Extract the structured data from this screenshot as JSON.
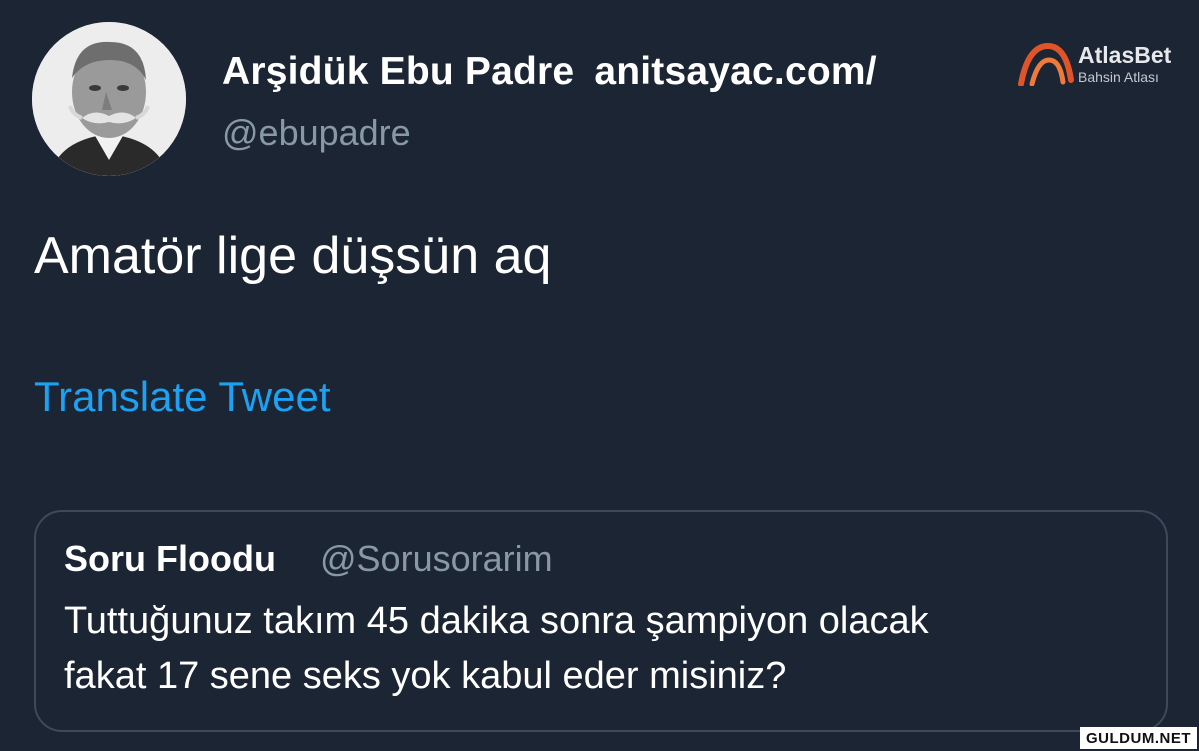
{
  "author": {
    "display_name": "Arşidük Ebu Padre",
    "display_name_suffix": "anitsayac.com/",
    "handle": "@ebupadre",
    "avatar": "profile-photo"
  },
  "brand": {
    "name": "AtlasBet",
    "tagline": "Bahsin Atlası",
    "logo": "atlasbet-arc-logo",
    "accent": "#e0542a"
  },
  "tweet": {
    "text": "Amatör lige düşsün aq",
    "translate_label": "Translate Tweet"
  },
  "quoted_tweet": {
    "name": "Soru Floodu",
    "handle": "@Sorusorarim",
    "line1": "Tuttuğunuz takım 45 dakika sonra şampiyon olacak",
    "line2": "fakat 17 sene seks yok kabul eder misiniz?"
  },
  "watermark": "GULDUM.NET",
  "colors": {
    "background": "#1c2533",
    "link": "#1da1f2",
    "secondary_text": "#8899a6",
    "card_border": "#3d4a5a"
  }
}
